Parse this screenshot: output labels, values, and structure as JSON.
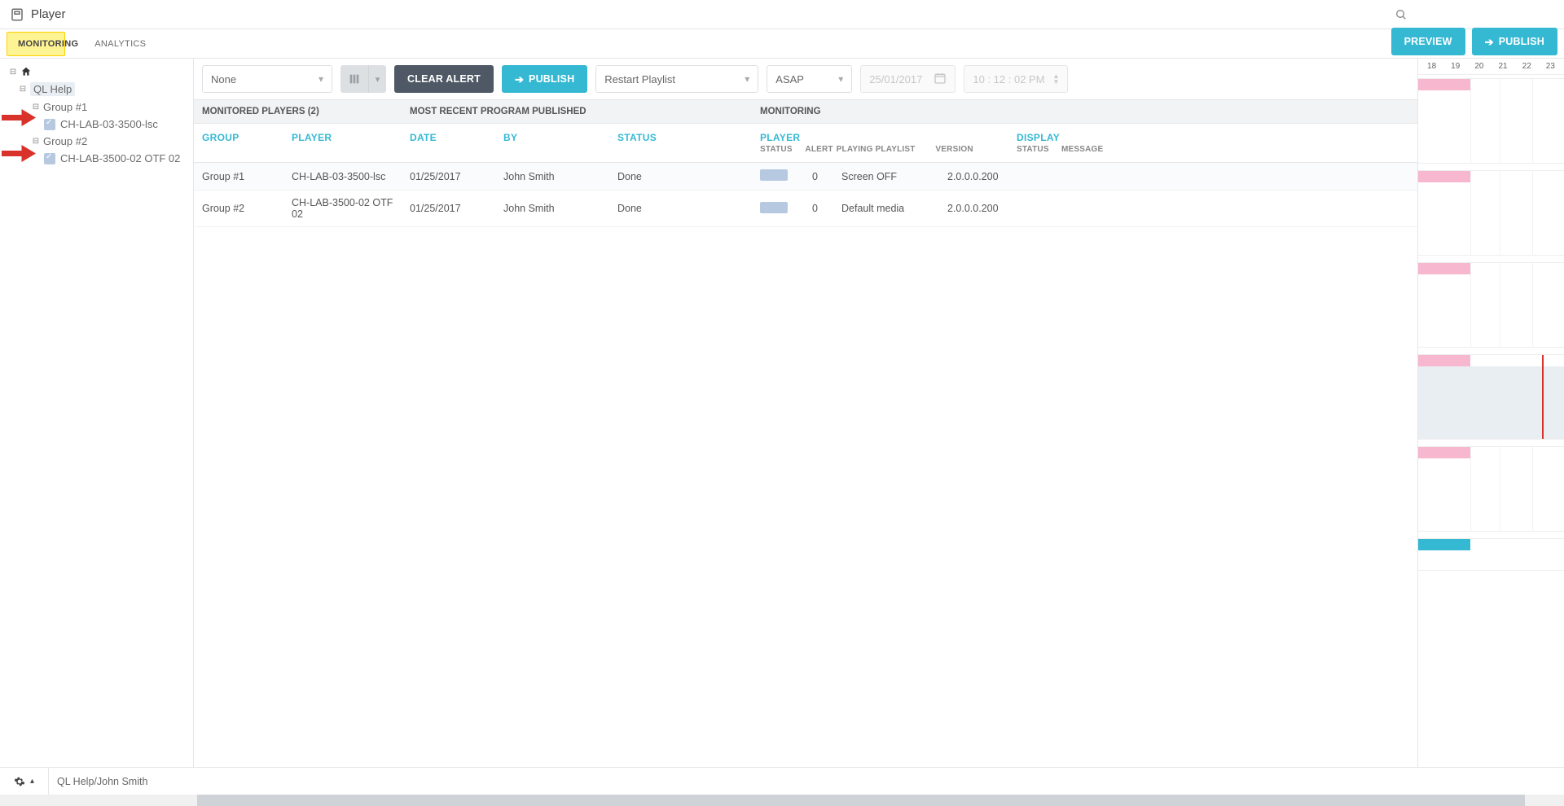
{
  "page_title": "Player",
  "tabs": {
    "monitoring": "MONITORING",
    "analytics": "ANALYTICS"
  },
  "actions": {
    "preview": "PREVIEW",
    "publish": "PUBLISH"
  },
  "tree": {
    "root": "QL Help",
    "groups": [
      {
        "name": "Group #1",
        "player": "CH-LAB-03-3500-lsc"
      },
      {
        "name": "Group #2",
        "player": "CH-LAB-3500-02 OTF 02"
      }
    ]
  },
  "toolbar": {
    "filter": "None",
    "clear_alert": "CLEAR ALERT",
    "publish": "PUBLISH",
    "mode": "Restart Playlist",
    "when": "ASAP",
    "date_placeholder": "25/01/2017",
    "time_placeholder": "10 : 12 : 02 PM"
  },
  "grid": {
    "sections": {
      "monitored": "MONITORED PLAYERS (2)",
      "recent": "MOST RECENT PROGRAM PUBLISHED",
      "monitoring": "MONITORING"
    },
    "headers": {
      "group": "GROUP",
      "player": "PLAYER",
      "date": "DATE",
      "by": "BY",
      "status": "STATUS",
      "p_player": "PLAYER",
      "p_status": "STATUS",
      "p_alert": "ALERT",
      "p_playlist": "PLAYING PLAYLIST",
      "p_version": "VERSION",
      "d_display": "DISPLAY",
      "d_status": "STATUS",
      "d_message": "MESSAGE"
    },
    "rows": [
      {
        "group": "Group #1",
        "player": "CH-LAB-03-3500-lsc",
        "date": "01/25/2017",
        "by": "John Smith",
        "status": "Done",
        "alert": "0",
        "playlist": "Screen OFF",
        "version": "2.0.0.0.200"
      },
      {
        "group": "Group #2",
        "player": "CH-LAB-3500-02 OTF 02",
        "date": "01/25/2017",
        "by": "John Smith",
        "status": "Done",
        "alert": "0",
        "playlist": "Default media",
        "version": "2.0.0.0.200"
      }
    ]
  },
  "timeline": {
    "hours": [
      "18",
      "19",
      "20",
      "21",
      "22",
      "23"
    ]
  },
  "footer": {
    "path": "QL Help/John Smith"
  }
}
